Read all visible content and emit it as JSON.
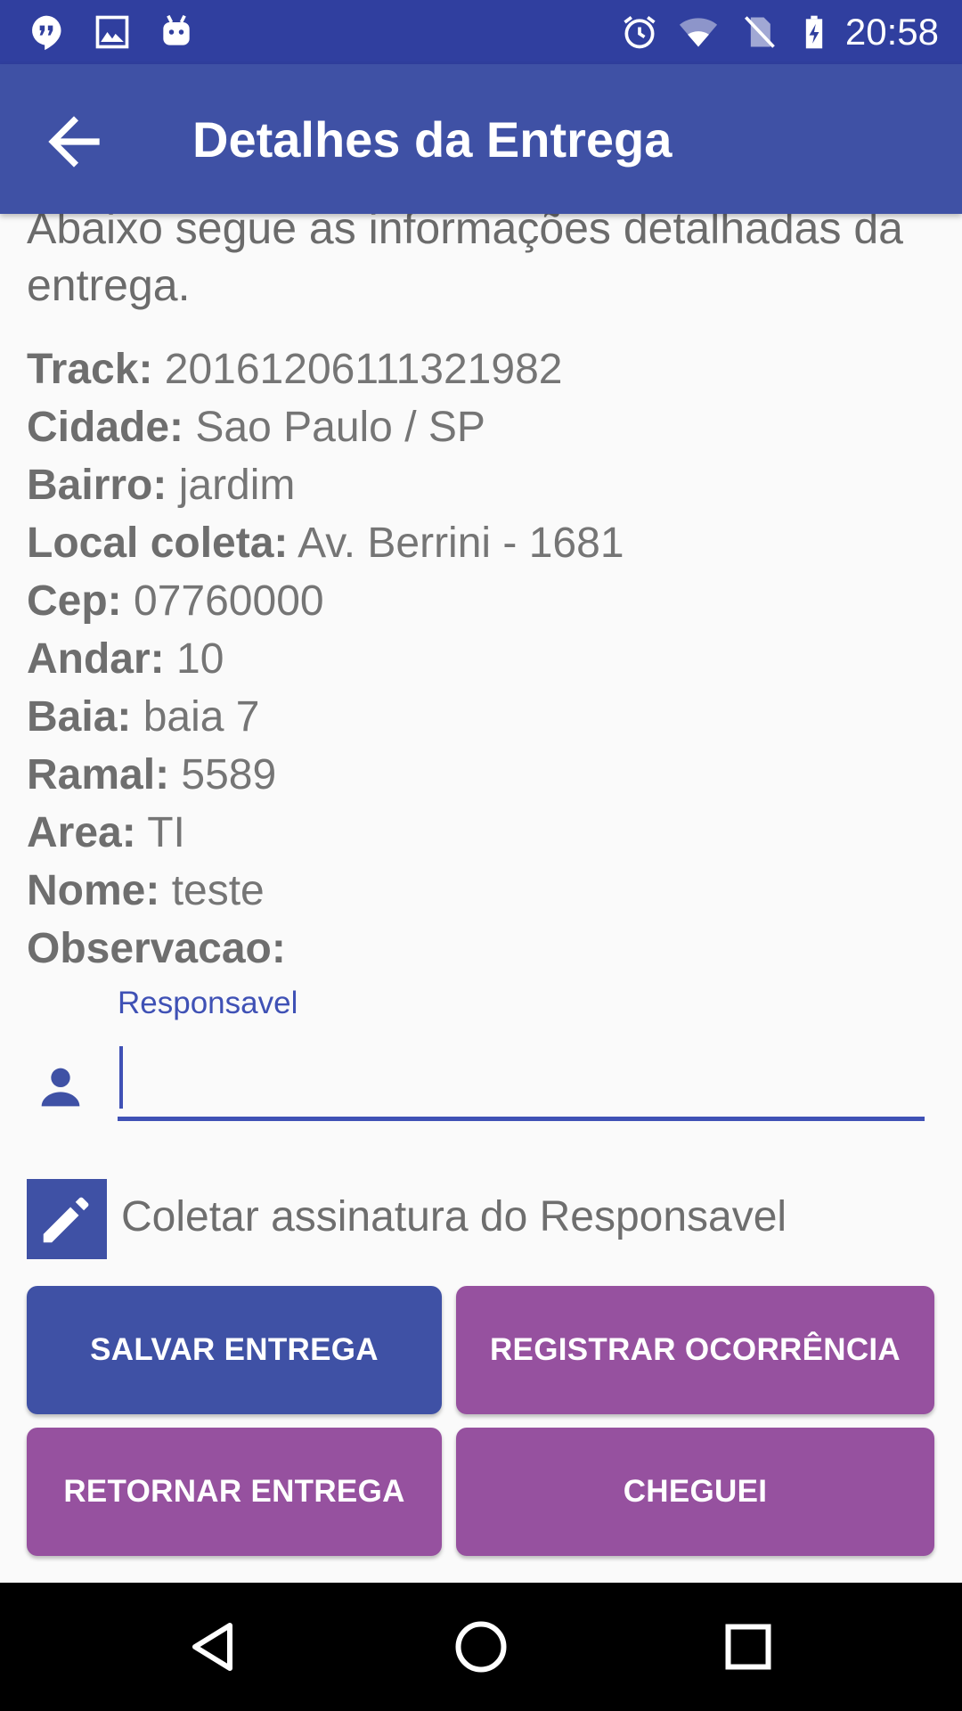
{
  "status_bar": {
    "time": "20:58",
    "left_icons": [
      "hangouts-icon",
      "image-icon",
      "android-icon"
    ],
    "right_icons": [
      "alarm-icon",
      "wifi-icon",
      "no-sim-icon",
      "battery-charging-icon"
    ]
  },
  "app_bar": {
    "title": "Detalhes da Entrega",
    "back_icon": "arrow-back-icon"
  },
  "intro_text": "Abaixo segue as informações detalhadas da entrega.",
  "details": [
    {
      "label": "Track:",
      "value": "20161206111321982"
    },
    {
      "label": "Cidade:",
      "value": "Sao Paulo / SP"
    },
    {
      "label": "Bairro:",
      "value": "jardim"
    },
    {
      "label": "Local coleta:",
      "value": "Av. Berrini - 1681"
    },
    {
      "label": "Cep:",
      "value": "07760000"
    },
    {
      "label": "Andar:",
      "value": "10"
    },
    {
      "label": "Baia:",
      "value": "baia 7"
    },
    {
      "label": "Ramal:",
      "value": "5589"
    },
    {
      "label": "Area:",
      "value": "TI"
    },
    {
      "label": "Nome:",
      "value": "teste"
    },
    {
      "label": "Observacao:",
      "value": ""
    }
  ],
  "responsavel": {
    "label": "Responsavel",
    "value": "",
    "icon": "person-icon"
  },
  "signature": {
    "label": "Coletar assinatura do Responsavel",
    "icon": "pencil-icon"
  },
  "buttons": {
    "salvar": "SALVAR ENTREGA",
    "registrar": "REGISTRAR OCORRÊNCIA",
    "retornar": "RETORNAR ENTREGA",
    "cheguei": "CHEGUEI"
  },
  "colors": {
    "primary": "#3f51a5",
    "primary_dark": "#303f9f",
    "accent": "#96519f"
  }
}
